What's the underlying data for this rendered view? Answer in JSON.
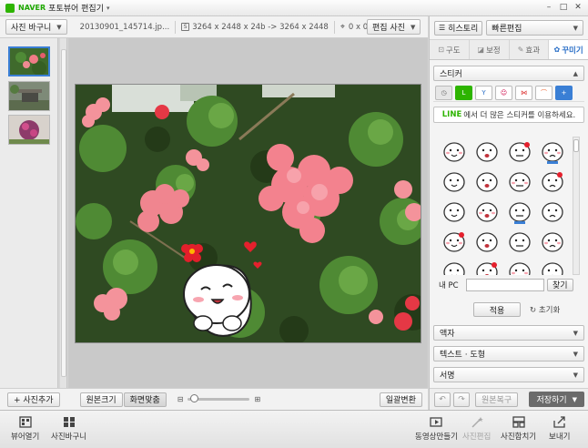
{
  "titlebar": {
    "brand": "NAVER",
    "title": "포토뷰어 편집기",
    "menu_arrow": "▾",
    "controls": [
      "–",
      "□",
      "✕"
    ]
  },
  "toolbar": {
    "album_button": "사진 바구니",
    "filename": "20130901_145714.jp...",
    "size_info": "3264 x 2448 x 24b -> 3264 x 2448",
    "coord": "0 x 0",
    "edit_mode_button": "편집 사진"
  },
  "left": {
    "add_photo_button": "+ 사진추가"
  },
  "editbar": {
    "original_size": "원본크기",
    "fit_screen": "화면맞춤",
    "batch_convert": "일괄변환",
    "zoom_fraction": 0.05
  },
  "right": {
    "history_button": "히스토리",
    "quick_edit_select": "빠른편집",
    "tabs": [
      {
        "label": "구도",
        "icon": "crop-icon"
      },
      {
        "label": "보정",
        "icon": "adjust-icon"
      },
      {
        "label": "효과",
        "icon": "effect-icon"
      },
      {
        "label": "꾸미기",
        "icon": "decorate-icon"
      }
    ],
    "sticker_section": "스티커",
    "line_promo_brand": "LINE",
    "line_promo_text": "에서 더 많은 스티커를 이용하세요.",
    "my_pc_label": "내 PC",
    "find_button": "찾기",
    "apply_button": "적용",
    "reset_button": "초기화",
    "frame_section": "액자",
    "text_shape_section": "텍스트 · 도형",
    "signature_section": "서명",
    "restore_button": "원본복구",
    "save_button": "저장하기"
  },
  "actions": {
    "viewer_open": "뷰어열기",
    "photo_basket": "사진바구니",
    "make_video": "동영상만들기",
    "photo_edit": "사진편집",
    "photo_merge": "사진합치기",
    "send": "보내기"
  },
  "colors": {
    "accent": "#2a6fc7",
    "line_green": "#2db400",
    "selection_blue": "#3a7fd5"
  }
}
